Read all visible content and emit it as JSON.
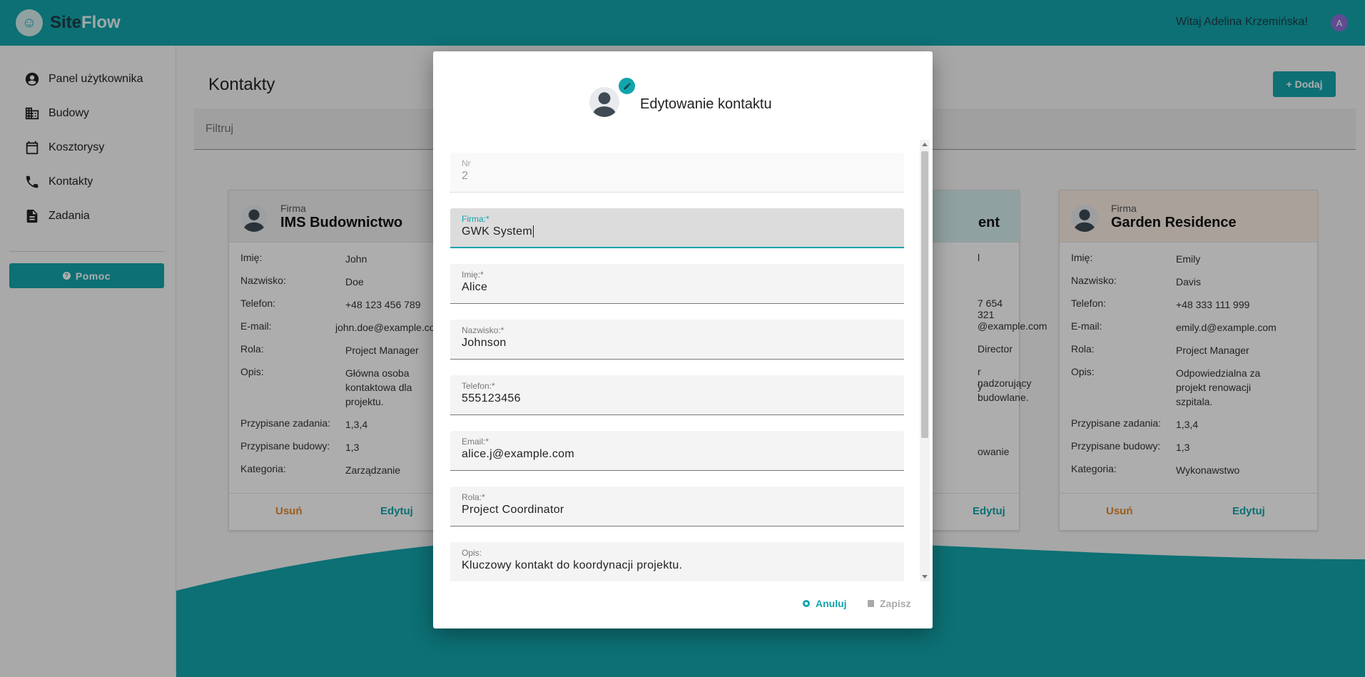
{
  "app": {
    "logo_mark": "☺",
    "name_a": "Site",
    "name_b": "Flow"
  },
  "header": {
    "greeting": "Witaj Adelina Krzemińska!",
    "avatar_letter": "A"
  },
  "sidebar": {
    "items": [
      {
        "label": "Panel użytkownika",
        "icon": "account-circle-icon"
      },
      {
        "label": "Budowy",
        "icon": "building-icon"
      },
      {
        "label": "Kosztorysy",
        "icon": "calendar-icon"
      },
      {
        "label": "Kontakty",
        "icon": "phone-icon"
      },
      {
        "label": "Zadania",
        "icon": "document-icon"
      }
    ],
    "help_label": "Pomoc"
  },
  "main": {
    "title": "Kontakty",
    "add_label": "+ Dodaj",
    "filter_placeholder": "Filtruj"
  },
  "cards": [
    {
      "company_label": "Firma",
      "company": "IMS Budownictwo",
      "rows": [
        {
          "k": "Imię:",
          "v": "John"
        },
        {
          "k": "Nazwisko:",
          "v": "Doe"
        },
        {
          "k": "Telefon:",
          "v": "+48 123 456 789"
        },
        {
          "k": "E-mail:",
          "v": "john.doe@example.com"
        },
        {
          "k": "Rola:",
          "v": "Project Manager"
        },
        {
          "k": "Opis:",
          "v": "Główna osoba kontaktowa dla projektu."
        },
        {
          "k": "Przypisane zadania:",
          "v": "1,3,4"
        },
        {
          "k": "Przypisane budowy:",
          "v": "1,3"
        },
        {
          "k": "Kategoria:",
          "v": "Zarządzanie"
        }
      ],
      "delete_label": "Usuń",
      "edit_label": "Edytuj"
    },
    {
      "company_fragment": "ent",
      "fragments": [
        "l",
        "7 654 321",
        "@example.com",
        "Director",
        "r nadzorujący",
        "y budowlane.",
        "owanie"
      ],
      "edit_label": "Edytuj"
    },
    {
      "company_label": "Firma",
      "company": "Garden Residence",
      "rows": [
        {
          "k": "Imię:",
          "v": "Emily"
        },
        {
          "k": "Nazwisko:",
          "v": "Davis"
        },
        {
          "k": "Telefon:",
          "v": "+48 333 111 999"
        },
        {
          "k": "E-mail:",
          "v": "emily.d@example.com"
        },
        {
          "k": "Rola:",
          "v": "Project Manager"
        },
        {
          "k": "Opis:",
          "v": "Odpowiedzialna za projekt renowacji szpitala."
        },
        {
          "k": "Przypisane zadania:",
          "v": "1,3,4"
        },
        {
          "k": "Przypisane budowy:",
          "v": "1,3"
        },
        {
          "k": "Kategoria:",
          "v": "Wykonawstwo"
        }
      ],
      "delete_label": "Usuń",
      "edit_label": "Edytuj"
    }
  ],
  "dialog": {
    "title": "Edytowanie kontaktu",
    "fields": [
      {
        "label": "Nr",
        "value": "2"
      },
      {
        "label": "Firma:*",
        "value": "GWK System"
      },
      {
        "label": "Imię:*",
        "value": "Alice"
      },
      {
        "label": "Nazwisko:*",
        "value": "Johnson"
      },
      {
        "label": "Telefon:*",
        "value": "555123456"
      },
      {
        "label": "Email:*",
        "value": "alice.j@example.com"
      },
      {
        "label": "Rola:*",
        "value": "Project Coordinator"
      },
      {
        "label": "Opis:",
        "value": "Kluczowy kontakt do koordynacji projektu."
      }
    ],
    "cancel_label": "Anuluj",
    "save_label": "Zapisz"
  },
  "colors": {
    "primary": "#12a5ac",
    "danger": "#e48a2e"
  }
}
